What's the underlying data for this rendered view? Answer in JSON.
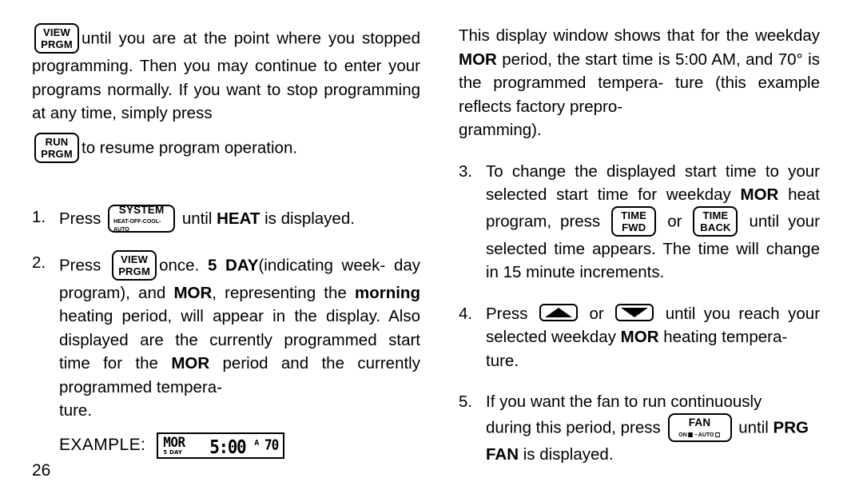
{
  "page": {
    "number": "26"
  },
  "keys": {
    "view_prgm": {
      "line1": "VIEW",
      "line2": "PRGM"
    },
    "run_prgm": {
      "line1": "RUN",
      "line2": "PRGM"
    },
    "system": {
      "line1": "SYSTEM",
      "sub": "HEAT-OFF-COOL-AUTO"
    },
    "time_fwd": {
      "line1": "TIME",
      "line2": "FWD"
    },
    "time_back": {
      "line1": "TIME",
      "line2": "BACK"
    },
    "fan": {
      "line1": "FAN",
      "sub_on": "ON",
      "sub_dash": "–",
      "sub_auto": "AUTO"
    },
    "arrow_up": {
      "label": "up-arrow"
    },
    "arrow_down": {
      "label": "down-arrow"
    }
  },
  "left_column": {
    "intro": {
      "after_key": "until you are at the point where you stopped programming.  Then you may continue to enter your programs normally.  If you want to stop programming at any time, simply press",
      "after_run_key": "to resume program operation."
    },
    "items": [
      {
        "number": "1.",
        "pre_key": "Press",
        "post_key_1": "until",
        "bold_1": "HEAT",
        "post_key_2": "is displayed."
      },
      {
        "number": "2.",
        "pre_key": "Press",
        "post_key_1": "once.",
        "bold_1": "5 DAY",
        "post_key_2": "(indicating week-",
        "rest_1": "day program), and",
        "bold_2": "MOR",
        "rest_2": ", representing the",
        "bold_3": "morning",
        "rest_3": "heating period, will appear in the display.  Also displayed are the currently programmed start time for the",
        "bold_4": "MOR",
        "rest_4": "period and the currently programmed tempera-",
        "rest_5": "ture."
      }
    ],
    "example": {
      "label": "EXAMPLE:",
      "lcd": {
        "period": "MOR",
        "day_mode": "5 DAY",
        "time": "5:00",
        "meridiem": "A",
        "temperature": "70"
      }
    }
  },
  "right_column": {
    "intro": "This display window shows that for the weekday",
    "intro_bold": "MOR",
    "intro_rest": "period, the start time is 5:00 AM, and 70° is the programmed tempera-ture (this example reflects factory prepro-gramming).",
    "intro_line2": "period, the start time is 5:00",
    "intro_line3": "AM, and 70° is the programmed tempera-",
    "intro_line4": "ture (this example reflects factory prepro-",
    "intro_line5": "gramming).",
    "items": [
      {
        "number": "3.",
        "text_1": "To change the displayed start time to your selected start time for weekday",
        "bold_1": "MOR",
        "text_2": "heat program, press",
        "text_3": "or",
        "text_4": "until your",
        "text_5": "selected time appears. The time will change in 15 minute increments."
      },
      {
        "number": "4.",
        "text_1": "Press",
        "text_2": "or",
        "text_3": "until you reach your selected weekday",
        "bold_1": "MOR",
        "text_4": "heating tempera-",
        "text_5": "ture."
      },
      {
        "number": "5.",
        "text_1": "If you want the fan to run continuously",
        "text_2": "during this period, press",
        "text_3": "until",
        "bold_1": "PRG",
        "bold_2": "FAN",
        "text_4": "is displayed."
      }
    ]
  }
}
